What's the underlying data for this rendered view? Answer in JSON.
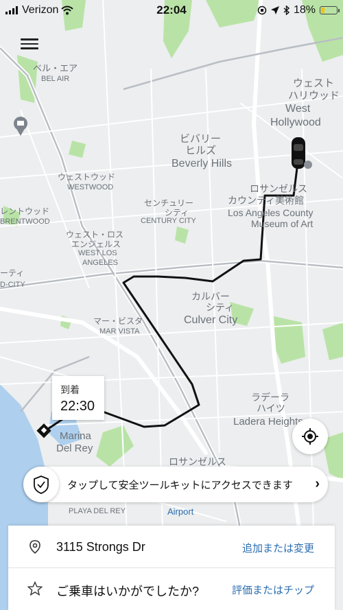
{
  "status_bar": {
    "carrier": "Verizon",
    "time": "22:04",
    "battery": "18%"
  },
  "map": {
    "labels": {
      "bel_air_jp": "ベル・エア",
      "bel_air": "BEL AIR",
      "west_hollywood_jp1": "ウェスト",
      "west_hollywood_jp2": "ハリウッド",
      "west": "West",
      "hollywood": "Hollywood",
      "beverly_hills_jp1": "ビバリー",
      "beverly_hills_jp2": "ヒルズ",
      "beverly_hills": "Beverly Hills",
      "westwood_jp": "ウェストウッド",
      "westwood": "WESTWOOD",
      "lacma_jp1": "ロサンゼルス",
      "lacma_jp2": "カウンティ美術館",
      "lacma1": "Los Angeles County",
      "lacma2": "Museum of Art",
      "brentwood_jp": "レントウッド",
      "brentwood": "BRENTWOOD",
      "century_city_jp1": "センチュリー",
      "century_city_jp2": "シティ",
      "century_city": "CENTURY CITY",
      "west_la_jp1": "ウェスト・ロス",
      "west_la_jp2": "エンジェルス",
      "west_la1": "WEST LOS",
      "west_la2": "ANGELES",
      "city_jp": "ーティ",
      "city": "D-CITY",
      "culver_city_jp1": "カルバー",
      "culver_city_jp2": "シティ",
      "culver_city": "Culver City",
      "mar_vista_jp": "マー・ビスタ",
      "mar_vista": "MAR VISTA",
      "ladera_jp1": "ラデーラ",
      "ladera_jp2": "ハイツ",
      "ladera": "Ladera Heights",
      "marina1": "Marina",
      "marina2": "Del Rey",
      "los_angeles_jp": "ロサンゼルス",
      "playa": "PLAYA DEL REY",
      "airport": "Airport"
    }
  },
  "eta": {
    "label": "到着",
    "time": "22:30"
  },
  "safety": {
    "text": "タップして安全ツールキットにアクセスできます",
    "chevron": "›"
  },
  "destination": {
    "address": "3115 Strongs Dr",
    "action": "追加または変更"
  },
  "rating": {
    "prompt": "ご乗車はいかがでしたか?",
    "action": "評価またはチップ"
  }
}
